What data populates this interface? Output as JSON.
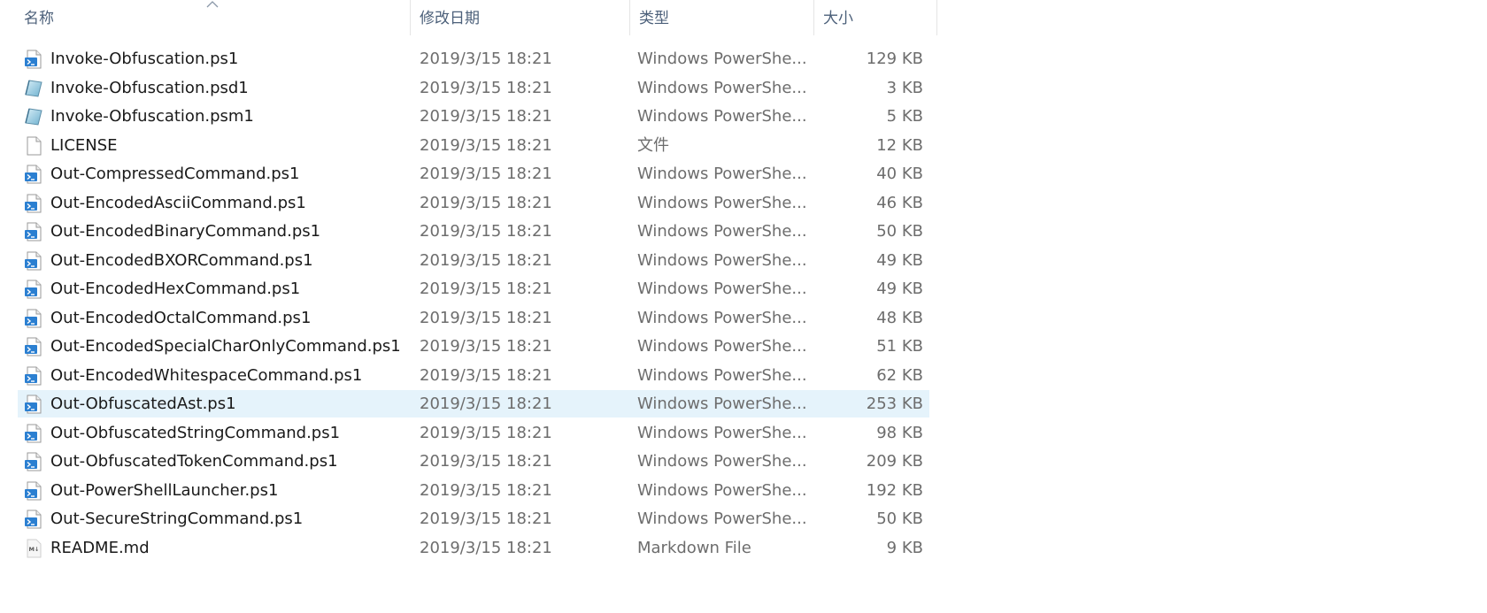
{
  "columns": {
    "name": "名称",
    "date": "修改日期",
    "type": "类型",
    "size": "大小"
  },
  "colors": {
    "header_text": "#4c607a",
    "selected_row_bg": "#e5f3fb",
    "ps_icon_blue": "#2b7fd1"
  },
  "files": [
    {
      "name": "Invoke-Obfuscation.ps1",
      "date": "2019/3/15 18:21",
      "type": "Windows PowerShe...",
      "size": "129 KB",
      "icon": "powershell-script-icon"
    },
    {
      "name": "Invoke-Obfuscation.psd1",
      "date": "2019/3/15 18:21",
      "type": "Windows PowerShe...",
      "size": "3 KB",
      "icon": "powershell-module-icon"
    },
    {
      "name": "Invoke-Obfuscation.psm1",
      "date": "2019/3/15 18:21",
      "type": "Windows PowerShe...",
      "size": "5 KB",
      "icon": "powershell-module-icon"
    },
    {
      "name": "LICENSE",
      "date": "2019/3/15 18:21",
      "type": "文件",
      "size": "12 KB",
      "icon": "blank-file-icon"
    },
    {
      "name": "Out-CompressedCommand.ps1",
      "date": "2019/3/15 18:21",
      "type": "Windows PowerShe...",
      "size": "40 KB",
      "icon": "powershell-script-icon"
    },
    {
      "name": "Out-EncodedAsciiCommand.ps1",
      "date": "2019/3/15 18:21",
      "type": "Windows PowerShe...",
      "size": "46 KB",
      "icon": "powershell-script-icon"
    },
    {
      "name": "Out-EncodedBinaryCommand.ps1",
      "date": "2019/3/15 18:21",
      "type": "Windows PowerShe...",
      "size": "50 KB",
      "icon": "powershell-script-icon"
    },
    {
      "name": "Out-EncodedBXORCommand.ps1",
      "date": "2019/3/15 18:21",
      "type": "Windows PowerShe...",
      "size": "49 KB",
      "icon": "powershell-script-icon"
    },
    {
      "name": "Out-EncodedHexCommand.ps1",
      "date": "2019/3/15 18:21",
      "type": "Windows PowerShe...",
      "size": "49 KB",
      "icon": "powershell-script-icon"
    },
    {
      "name": "Out-EncodedOctalCommand.ps1",
      "date": "2019/3/15 18:21",
      "type": "Windows PowerShe...",
      "size": "48 KB",
      "icon": "powershell-script-icon"
    },
    {
      "name": "Out-EncodedSpecialCharOnlyCommand.ps1",
      "date": "2019/3/15 18:21",
      "type": "Windows PowerShe...",
      "size": "51 KB",
      "icon": "powershell-script-icon"
    },
    {
      "name": "Out-EncodedWhitespaceCommand.ps1",
      "date": "2019/3/15 18:21",
      "type": "Windows PowerShe...",
      "size": "62 KB",
      "icon": "powershell-script-icon"
    },
    {
      "name": "Out-ObfuscatedAst.ps1",
      "date": "2019/3/15 18:21",
      "type": "Windows PowerShe...",
      "size": "253 KB",
      "icon": "powershell-script-icon",
      "selected": true
    },
    {
      "name": "Out-ObfuscatedStringCommand.ps1",
      "date": "2019/3/15 18:21",
      "type": "Windows PowerShe...",
      "size": "98 KB",
      "icon": "powershell-script-icon"
    },
    {
      "name": "Out-ObfuscatedTokenCommand.ps1",
      "date": "2019/3/15 18:21",
      "type": "Windows PowerShe...",
      "size": "209 KB",
      "icon": "powershell-script-icon"
    },
    {
      "name": "Out-PowerShellLauncher.ps1",
      "date": "2019/3/15 18:21",
      "type": "Windows PowerShe...",
      "size": "192 KB",
      "icon": "powershell-script-icon"
    },
    {
      "name": "Out-SecureStringCommand.ps1",
      "date": "2019/3/15 18:21",
      "type": "Windows PowerShe...",
      "size": "50 KB",
      "icon": "powershell-script-icon"
    },
    {
      "name": "README.md",
      "date": "2019/3/15 18:21",
      "type": "Markdown File",
      "size": "9 KB",
      "icon": "markdown-file-icon"
    }
  ]
}
